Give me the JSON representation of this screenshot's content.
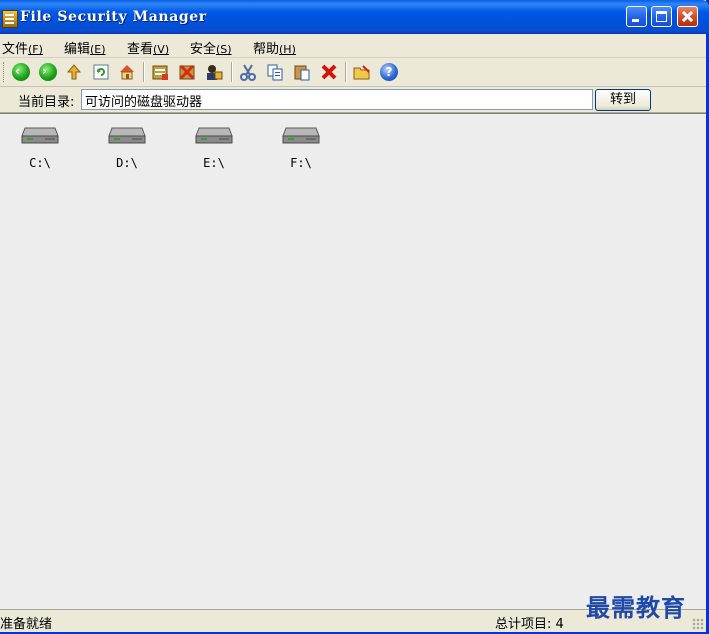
{
  "window": {
    "title": "File Security Manager"
  },
  "menu": [
    {
      "label": "文件",
      "accel": "(F)"
    },
    {
      "label": "编辑",
      "accel": "(E)"
    },
    {
      "label": "查看",
      "accel": "(V)"
    },
    {
      "label": "安全",
      "accel": "(S)"
    },
    {
      "label": "帮助",
      "accel": "(H)"
    }
  ],
  "toolbar": {
    "icons": [
      "back-icon",
      "forward-icon",
      "up-folder-icon",
      "refresh-icon",
      "home-icon",
      "encrypt-icon",
      "decrypt-icon",
      "user-permissions-icon",
      "cut-icon",
      "copy-icon",
      "paste-icon",
      "delete-icon",
      "open-folder-icon",
      "help-icon"
    ]
  },
  "address": {
    "label": "当前目录:",
    "value": "可访问的磁盘驱动器",
    "go_label": "转到"
  },
  "drives": [
    {
      "label": "C:\\"
    },
    {
      "label": "D:\\"
    },
    {
      "label": "E:\\"
    },
    {
      "label": "F:\\"
    }
  ],
  "status": {
    "left": "准备就绪",
    "right": "总计项目: 4"
  },
  "watermark": "最需教育"
}
